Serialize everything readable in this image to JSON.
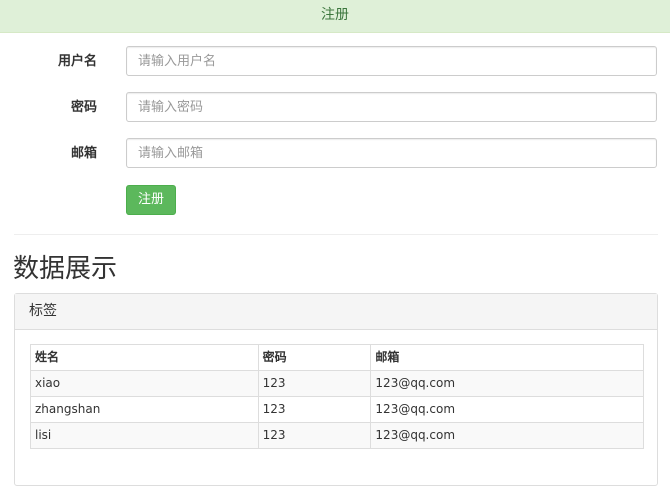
{
  "banner": {
    "text": "注册"
  },
  "form": {
    "fields": [
      {
        "label": "用户名",
        "placeholder": "请输入用户名",
        "value": ""
      },
      {
        "label": "密码",
        "placeholder": "请输入密码",
        "value": ""
      },
      {
        "label": "邮箱",
        "placeholder": "请输入邮箱",
        "value": ""
      }
    ],
    "submit_label": "注册"
  },
  "section": {
    "title": "数据展示"
  },
  "panel": {
    "heading": "标签",
    "table": {
      "headers": [
        "姓名",
        "密码",
        "邮箱"
      ],
      "rows": [
        [
          "xiao",
          "123",
          "123@qq.com"
        ],
        [
          "zhangshan",
          "123",
          "123@qq.com"
        ],
        [
          "lisi",
          "123",
          "123@qq.com"
        ]
      ]
    }
  },
  "colors": {
    "banner_bg": "#dff0d8",
    "banner_text": "#3c763d",
    "button_bg": "#5cb85c",
    "border": "#dddddd"
  }
}
